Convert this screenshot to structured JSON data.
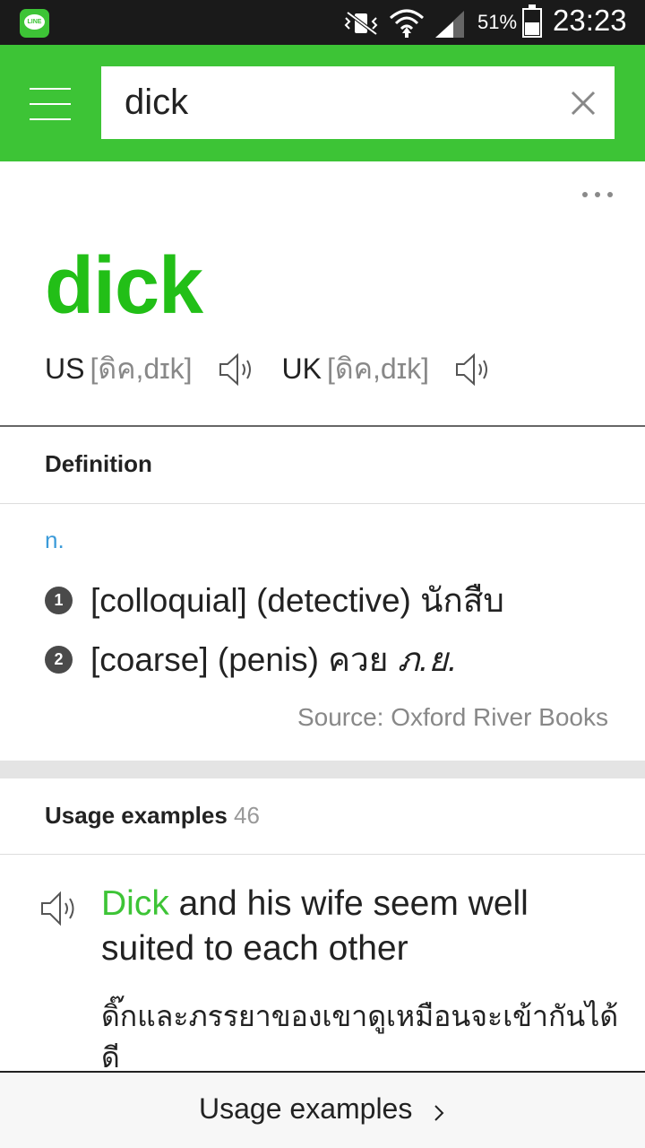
{
  "status_bar": {
    "battery_percent": "51%",
    "battery_level": 0.51,
    "time": "23:23",
    "app_icon_label": "LINE",
    "icons": [
      "vibrate-off-icon",
      "wifi-icon",
      "signal-icon",
      "battery-icon"
    ]
  },
  "search": {
    "value": "dick"
  },
  "entry": {
    "headword": "dick",
    "us_label": "US",
    "us_pron": "[ดิค,dɪk]",
    "uk_label": "UK",
    "uk_pron": "[ดิค,dɪk]"
  },
  "definition": {
    "section_title": "Definition",
    "pos": "n.",
    "items": [
      {
        "num": "1",
        "text": "[colloquial] (detective) นักสืบ",
        "suffix": ""
      },
      {
        "num": "2",
        "text": "[coarse] (penis) ควย ",
        "suffix": "ภ.ย."
      }
    ],
    "source": "Source: Oxford River Books"
  },
  "usage": {
    "section_title": "Usage examples",
    "count": "46",
    "example": {
      "highlight": "Dick",
      "rest": " and his wife seem well suited to each other",
      "translation": "ดิ๊กและภรรยาของเขาดูเหมือนจะเข้ากันได้ดี"
    }
  },
  "bottom_bar": {
    "label": "Usage examples"
  },
  "colors": {
    "brand_green": "#3dc436",
    "headword_green": "#22bf17",
    "pos_blue": "#3a9ad9"
  }
}
